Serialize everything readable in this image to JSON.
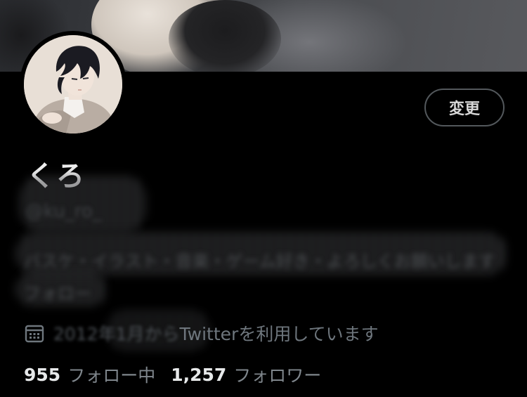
{
  "profile": {
    "display_name": "くろ",
    "handle": "@ku_ro_",
    "edit_button_label": "変更",
    "bio_line1": "バスケ・イラスト・音楽・ゲーム好き・よろしくお願いします",
    "bio_line2": "フォロー",
    "joined_blurred": "2012年1月から",
    "joined_visible": "Twitterを利用しています",
    "following_count": "955",
    "following_label": "フォロー中",
    "followers_count": "1,257",
    "followers_label": "フォロワー"
  },
  "icons": {
    "calendar": "calendar-icon"
  }
}
